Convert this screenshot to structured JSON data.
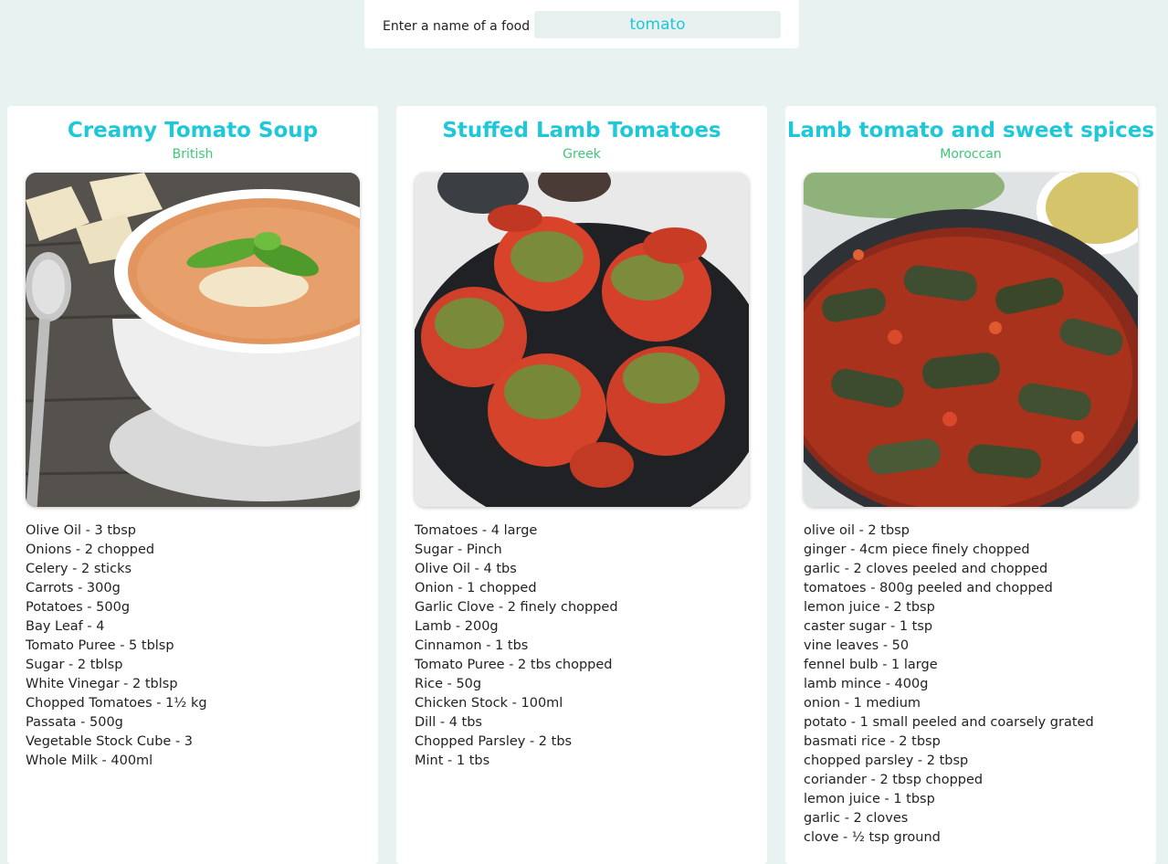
{
  "search": {
    "label": "Enter a name of a food",
    "value": "tomato"
  },
  "recipes": [
    {
      "title": "Creamy Tomato Soup",
      "cuisine": "British",
      "ingredients": [
        "Olive Oil - 3 tbsp",
        "Onions - 2 chopped",
        "Celery - 2 sticks",
        "Carrots - 300g",
        "Potatoes - 500g",
        "Bay Leaf - 4",
        "Tomato Puree - 5 tblsp",
        "Sugar - 2 tblsp",
        "White Vinegar - 2 tblsp",
        "Chopped Tomatoes - 1½ kg",
        "Passata - 500g",
        "Vegetable Stock Cube - 3",
        "Whole Milk - 400ml"
      ]
    },
    {
      "title": "Stuffed Lamb Tomatoes",
      "cuisine": "Greek",
      "ingredients": [
        "Tomatoes - 4 large",
        "Sugar - Pinch",
        "Olive Oil - 4 tbs",
        "Onion - 1 chopped",
        "Garlic Clove - 2 finely chopped",
        "Lamb - 200g",
        "Cinnamon - 1 tbs",
        "Tomato Puree - 2 tbs chopped",
        "Rice - 50g",
        "Chicken Stock - 100ml",
        "Dill - 4 tbs",
        "Chopped Parsley - 2 tbs",
        "Mint - 1 tbs"
      ]
    },
    {
      "title": "Lamb tomato and sweet spices",
      "cuisine": "Moroccan",
      "ingredients": [
        "olive oil - 2 tbsp",
        "ginger - 4cm piece finely chopped",
        "garlic - 2 cloves peeled and chopped",
        "tomatoes - 800g peeled and chopped",
        "lemon juice - 2 tbsp",
        "caster sugar - 1 tsp",
        "vine leaves - 50",
        "fennel bulb - 1 large",
        "lamb mince - 400g",
        "onion - 1 medium",
        "potato - 1 small peeled and coarsely grated",
        "basmati rice - 2 tbsp",
        "chopped parsley - 2 tbsp",
        "coriander - 2 tbsp chopped",
        "lemon juice - 1 tbsp",
        "garlic - 2 cloves",
        "clove - ½ tsp ground"
      ]
    }
  ]
}
